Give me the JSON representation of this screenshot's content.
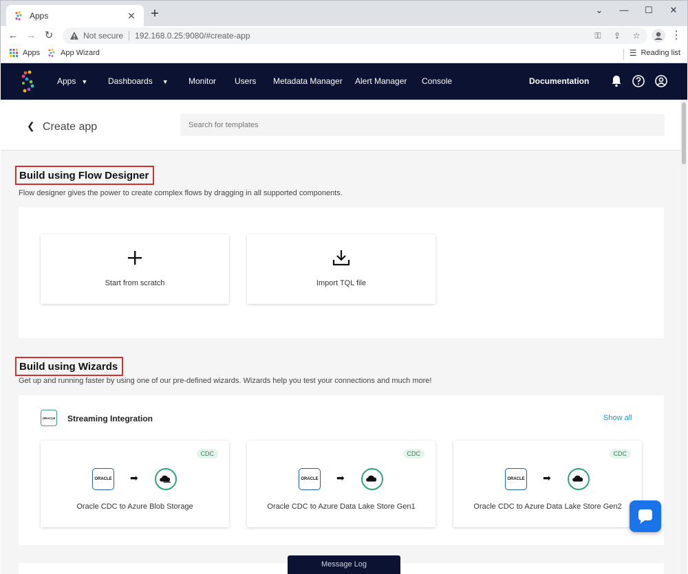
{
  "browser": {
    "tab_title": "Apps",
    "new_tab_label": "+",
    "not_secure": "Not secure",
    "url": "192.168.0.25:9080/#create-app",
    "bookmarks": [
      {
        "label": "Apps",
        "icon": "apps-grid-icon"
      },
      {
        "label": "App Wizard",
        "icon": "striim-logo-icon"
      }
    ],
    "reading_list": "Reading list"
  },
  "appnav": {
    "items": [
      {
        "label": "Apps",
        "has_caret": true
      },
      {
        "label": "Dashboards",
        "has_caret": true
      },
      {
        "label": "Monitor"
      },
      {
        "label": "Users"
      },
      {
        "label": "Metadata Manager"
      },
      {
        "label": "Alert Manager"
      },
      {
        "label": "Console"
      }
    ],
    "documentation": "Documentation"
  },
  "header": {
    "title": "Create app",
    "search_placeholder": "Search for templates"
  },
  "flow_designer": {
    "title": "Build using Flow Designer",
    "description": "Flow designer gives the power to create complex flows by dragging in all supported components.",
    "cards": [
      {
        "label": "Start from scratch",
        "icon": "plus-icon"
      },
      {
        "label": "Import TQL file",
        "icon": "download-icon"
      }
    ]
  },
  "wizards": {
    "title": "Build using Wizards",
    "description": "Get up and running faster by using one of our pre-defined wizards. Wizards help you test your connections and much more!",
    "group_title": "Streaming Integration",
    "group_badge": "ORACLE",
    "show_all": "Show all",
    "cards": [
      {
        "label": "Oracle CDC to Azure Blob Storage",
        "tag": "CDC",
        "source": "ORACLE"
      },
      {
        "label": "Oracle CDC to Azure Data Lake Store Gen1",
        "tag": "CDC",
        "source": "ORACLE"
      },
      {
        "label": "Oracle CDC to Azure Data Lake Store Gen2",
        "tag": "CDC",
        "source": "ORACLE"
      }
    ]
  },
  "footer": {
    "message_log": "Message Log"
  },
  "colors": {
    "nav_bg": "#0c1332",
    "highlight_border": "#d32f2f",
    "accent_link": "#1a9bc4",
    "chat_button": "#1a73e8"
  }
}
